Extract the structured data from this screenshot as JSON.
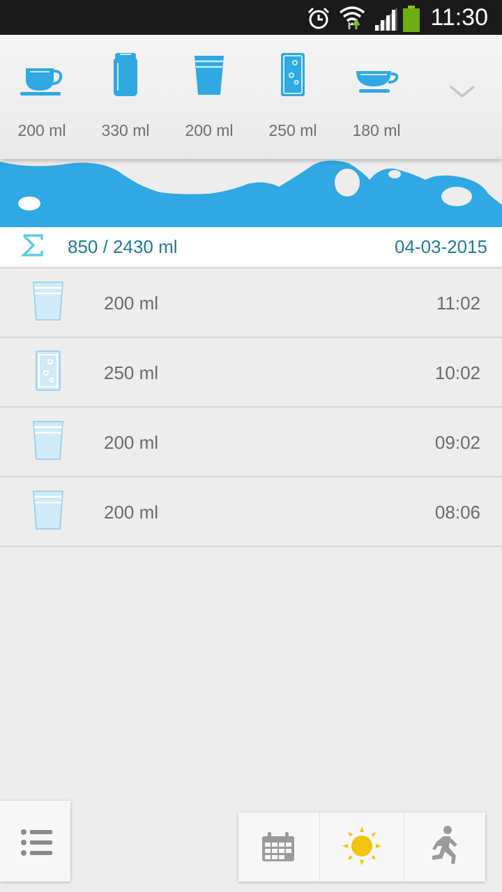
{
  "status_bar": {
    "time": "11:30"
  },
  "drink_options": [
    {
      "icon": "coffee-cup-icon",
      "label": "200 ml"
    },
    {
      "icon": "can-icon",
      "label": "330 ml"
    },
    {
      "icon": "cup-icon",
      "label": "200 ml"
    },
    {
      "icon": "sparkling-glass-icon",
      "label": "250 ml"
    },
    {
      "icon": "tea-cup-icon",
      "label": "180 ml"
    }
  ],
  "summary": {
    "total": "850 / 2430 ml",
    "date": "04-03-2015",
    "progress_fraction": 0.35
  },
  "entries": [
    {
      "icon": "cup-icon",
      "amount": "200 ml",
      "time": "11:02"
    },
    {
      "icon": "sparkling-glass-icon",
      "amount": "250 ml",
      "time": "10:02"
    },
    {
      "icon": "cup-icon",
      "amount": "200 ml",
      "time": "09:02"
    },
    {
      "icon": "cup-icon",
      "amount": "200 ml",
      "time": "08:06"
    }
  ],
  "colors": {
    "accent": "#2fa8e3",
    "text_accent": "#1f7a95",
    "sun": "#f2c40f"
  }
}
